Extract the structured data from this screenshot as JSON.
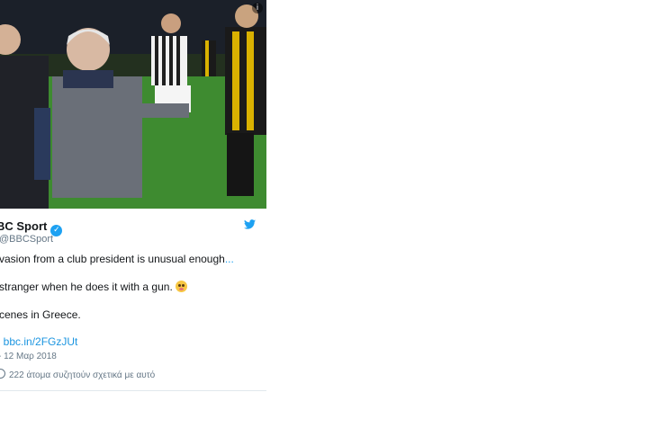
{
  "tweet": {
    "author_name": "BC Sport",
    "verified": true,
    "handle": "@BBCSport",
    "text_line1": "vasion from a club president is unusual enough",
    "text_line1_more": "...",
    "text_line2": "stranger when he does it with a gun.",
    "text_line3": "cenes in Greece.",
    "link_prefix": ": ",
    "link_text": "bbc.in/2FGzJUt",
    "date": "- 12 Μαρ 2018",
    "talk_text": "222 άτομα συζητούν σχετικά με αυτό",
    "colors": {
      "accent": "#1da1f2",
      "meta": "#657786"
    }
  }
}
